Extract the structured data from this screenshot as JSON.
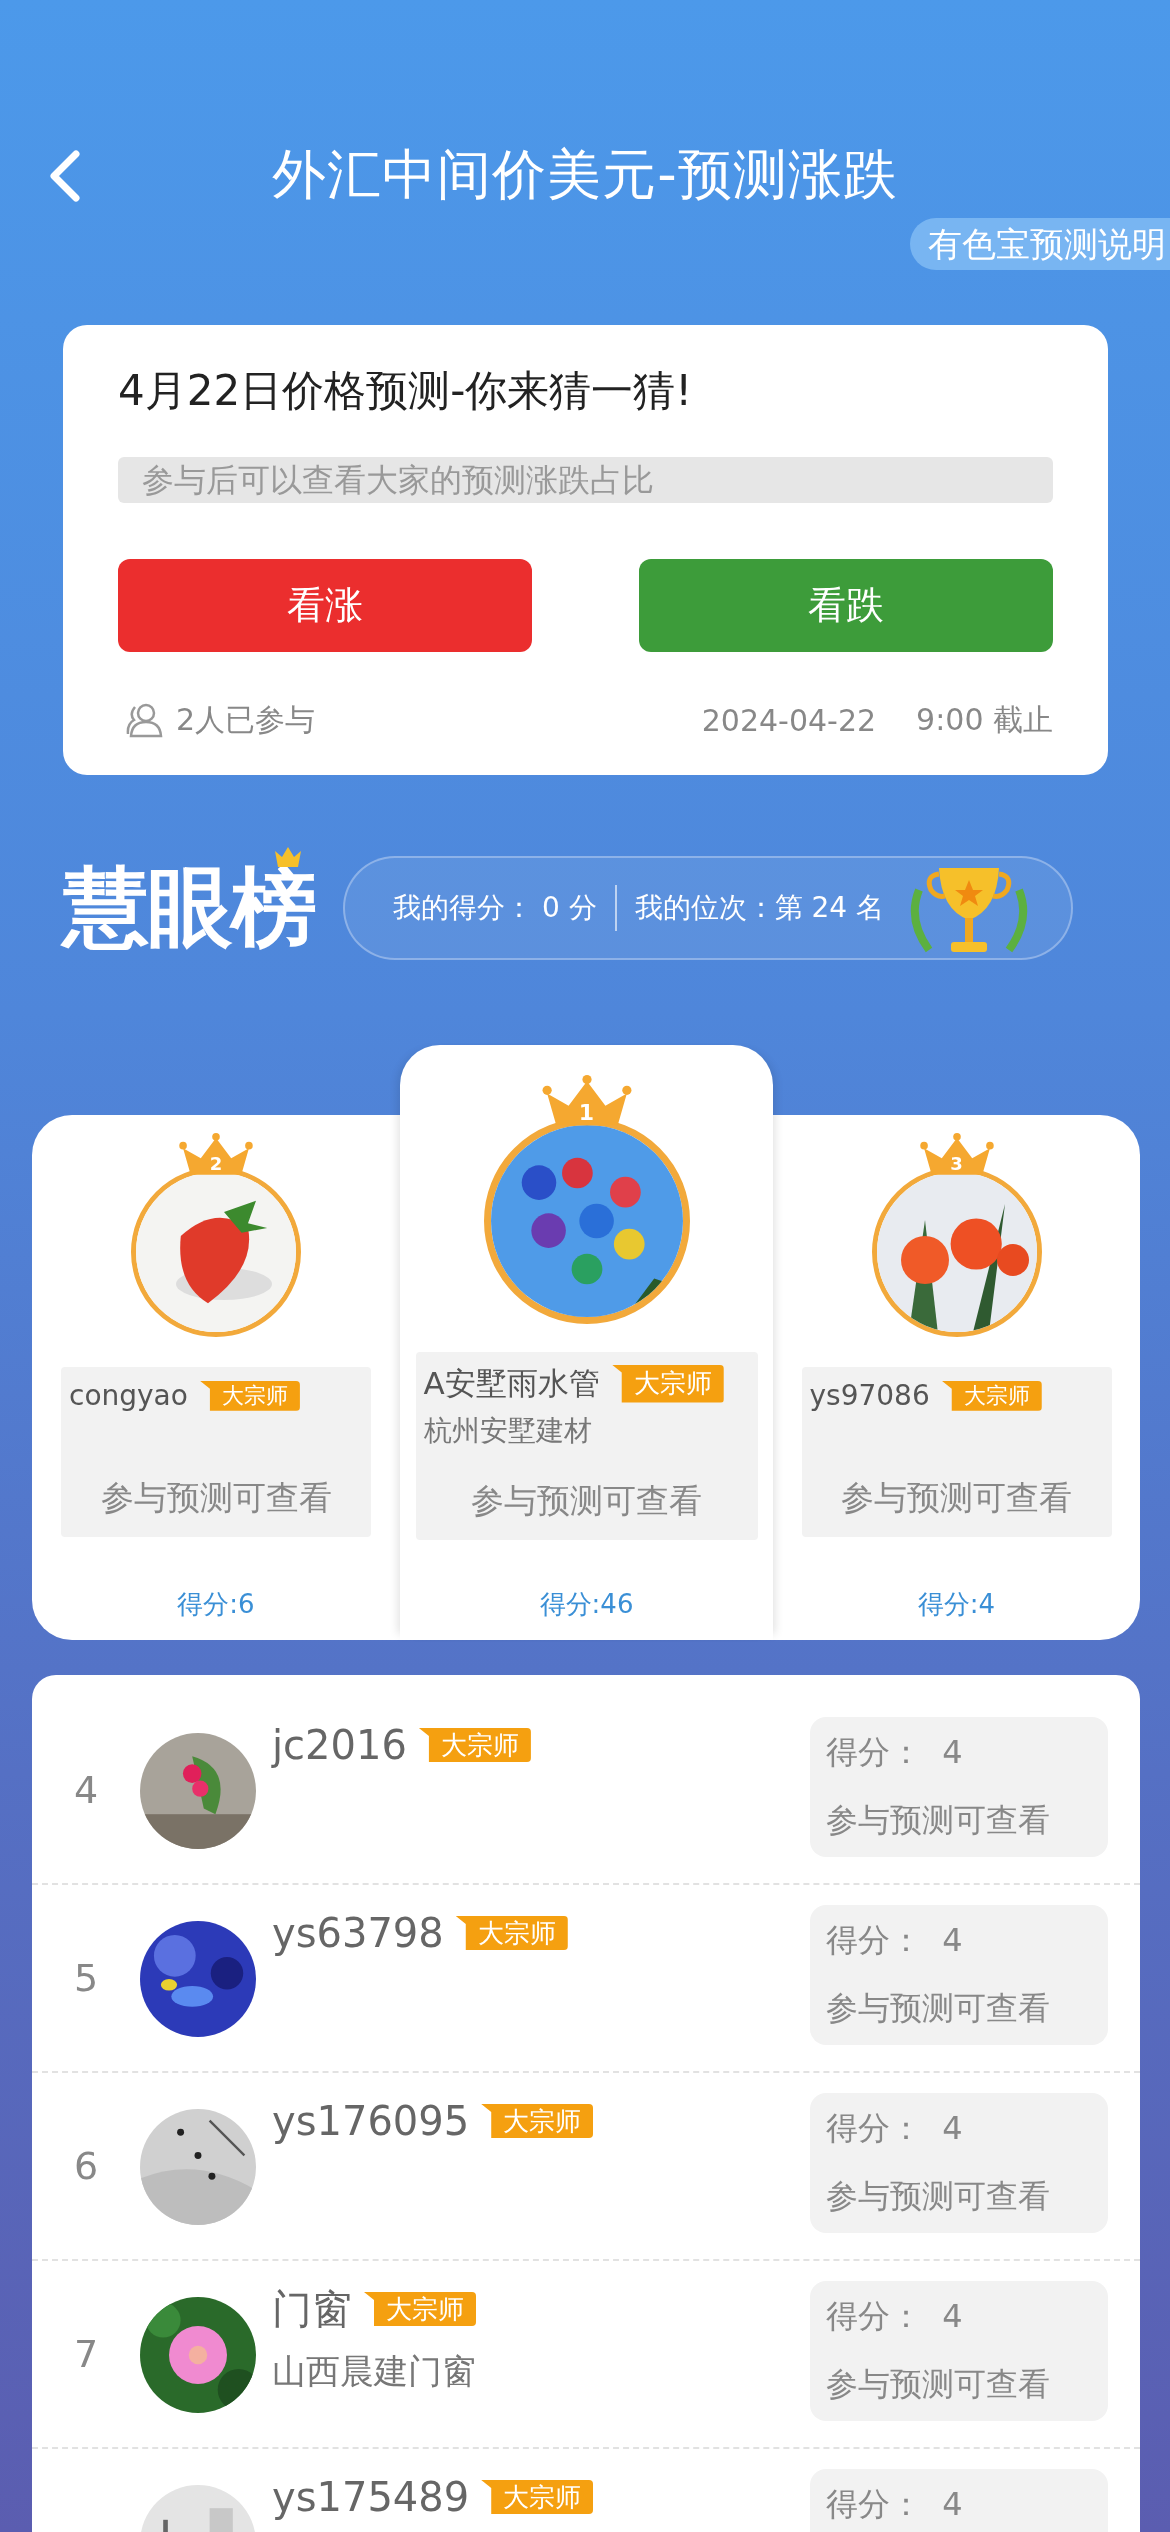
{
  "header": {
    "title": "外汇中间价美元-预测涨跌",
    "info_link": "有色宝预测说明"
  },
  "prediction": {
    "title": "4月22日价格预测-你来猜一猜!",
    "hint": "参与后可以查看大家的预测涨跌占比",
    "buttons": [
      {
        "label": "看涨",
        "kind": "up"
      },
      {
        "label": "看跌",
        "kind": "down"
      }
    ],
    "participants": "2人已参与",
    "deadline_date": "2024-04-22",
    "deadline_time": "9:00 截止"
  },
  "leaderboard": {
    "logo": "慧眼榜",
    "my_score": "我的得分：  0 分",
    "my_rank": "我的位次：第 24 名"
  },
  "podium": [
    {
      "rank": "2",
      "name": "congyao",
      "badge": "大宗师",
      "locked_text": "参与预测可查看",
      "score": "得分:6"
    },
    {
      "rank": "1",
      "name": "A安墅雨水管",
      "badge": "大宗师",
      "org": "杭州安墅建材",
      "locked_text": "参与预测可查看",
      "score": "得分:46"
    },
    {
      "rank": "3",
      "name": "ys97086",
      "badge": "大宗师",
      "locked_text": "参与预测可查看",
      "score": "得分:4"
    }
  ],
  "rankings": [
    {
      "rank": "4",
      "name": "jc2016",
      "badge": "大宗师",
      "score": "得分：  4",
      "locked_text": "参与预测可查看"
    },
    {
      "rank": "5",
      "name": "ys63798",
      "badge": "大宗师",
      "score": "得分：  4",
      "locked_text": "参与预测可查看"
    },
    {
      "rank": "6",
      "name": "ys176095",
      "badge": "大宗师",
      "score": "得分：  4",
      "locked_text": "参与预测可查看"
    },
    {
      "rank": "7",
      "name": "门窗",
      "badge": "大宗师",
      "org": "山西晨建门窗",
      "score": "得分：  4",
      "locked_text": "参与预测可查看"
    },
    {
      "name": "ys175489",
      "badge": "大宗师",
      "score": "得分：  4"
    }
  ]
}
